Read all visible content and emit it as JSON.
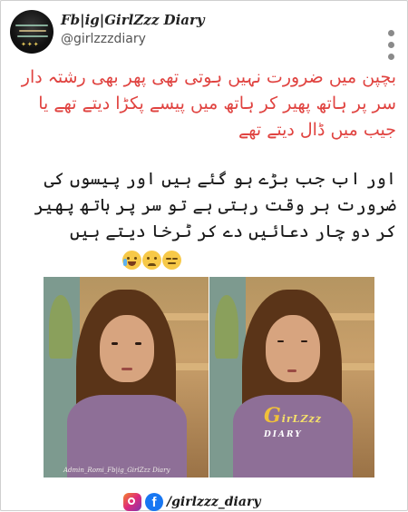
{
  "post": {
    "author_name": "Fb|ig|GirlZzz Diary",
    "author_handle": "@girlzzzdiary",
    "caption_red": "بچپن میں ضرورت نہیں ہوتی تھی پھر بھی رشتہ دار سر پر ہاتھ پھیر کر ہاتھ میں پیسے پکڑا دیتے تھے یا جیب میں ڈال دیتے تھے",
    "caption_black": "اور اب جب بڑے ہو گئے ہیں اور پیسوں کی ضرورت ہر وقت رہتی ہے تو سر پر ہاتھ پھیر کر دو چار دعائیں دے کر ٹرخا دیتے ہیں",
    "emojis": [
      "face-with-tears-of-joy",
      "confused-face",
      "expressionless-face"
    ]
  },
  "image": {
    "watermark": "Admin_Romi_Fb|ig_GirlZzz Diary",
    "logo_initial": "G",
    "logo_top": "irLZzz",
    "logo_bottom": "DIARY"
  },
  "footer": {
    "social_handle": "/girlzzz_diary"
  }
}
